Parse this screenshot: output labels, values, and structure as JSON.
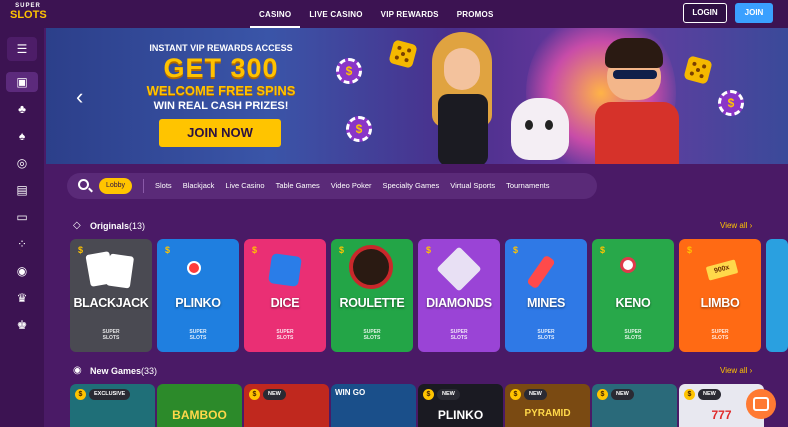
{
  "logo": {
    "top": "SUPER",
    "bottom": "SLOTS"
  },
  "nav": [
    {
      "label": "CASINO",
      "active": true
    },
    {
      "label": "LIVE CASINO",
      "active": false
    },
    {
      "label": "VIP REWARDS",
      "active": false
    },
    {
      "label": "PROMOS",
      "active": false
    }
  ],
  "auth": {
    "login": "LOGIN",
    "join": "JOIN"
  },
  "sidebar": {
    "menu_icon": "hamburger-menu-icon",
    "items": [
      {
        "icon": "casino-chips-icon",
        "glyph": "▣",
        "selected": true
      },
      {
        "icon": "cherry-icon",
        "glyph": "♣"
      },
      {
        "icon": "spade-icon",
        "glyph": "♠"
      },
      {
        "icon": "lottery-icon",
        "glyph": "◎"
      },
      {
        "icon": "cards-icon",
        "glyph": "▤"
      },
      {
        "icon": "laptop-icon",
        "glyph": "▭"
      },
      {
        "icon": "dice-dots-icon",
        "glyph": "⁘"
      },
      {
        "icon": "basketball-icon",
        "glyph": "◉"
      },
      {
        "icon": "trophy-icon",
        "glyph": "♛"
      },
      {
        "icon": "crown-icon",
        "glyph": "♚"
      }
    ]
  },
  "hero": {
    "line1": "INSTANT VIP REWARDS ACCESS",
    "line2": "GET 300",
    "line3": "WELCOME FREE SPINS",
    "line4": "WIN REAL CASH PRIZES!",
    "cta": "JOIN NOW",
    "prev_arrow": "‹",
    "chip_symbol": "$"
  },
  "search": {
    "active": "Lobby",
    "categories": [
      "Slots",
      "Blackjack",
      "Live Casino",
      "Table Games",
      "Video Poker",
      "Specialty Games",
      "Virtual Sports",
      "Tournaments"
    ]
  },
  "originals": {
    "title": "Originals",
    "count": "(13)",
    "view_all": "View all ›",
    "games": [
      {
        "name": "BLACKJACK",
        "color": "#4a4a52",
        "brand1": "SUPER",
        "brand2": "SLOTS"
      },
      {
        "name": "PLINKO",
        "color": "#1f7fe0",
        "brand1": "SUPER",
        "brand2": "SLOTS"
      },
      {
        "name": "DICE",
        "color": "#ea2f74",
        "brand1": "SUPER",
        "brand2": "SLOTS"
      },
      {
        "name": "ROULETTE",
        "color": "#23a547",
        "brand1": "SUPER",
        "brand2": "SLOTS"
      },
      {
        "name": "DIAMONDS",
        "color": "#9a44d6",
        "brand1": "SUPER",
        "brand2": "SLOTS"
      },
      {
        "name": "MINES",
        "color": "#2f79e6",
        "brand1": "SUPER",
        "brand2": "SLOTS"
      },
      {
        "name": "KENO",
        "color": "#28a84a",
        "brand1": "SUPER",
        "brand2": "SLOTS"
      },
      {
        "name": "LIMBO",
        "color": "#ff6a14",
        "brand1": "SUPER",
        "brand2": "SLOTS"
      }
    ],
    "dollar": "$",
    "limbo_tag": "900x"
  },
  "new_games": {
    "title": "New Games",
    "count": "(33)",
    "view_all": "View all ›",
    "games": [
      {
        "badge": "EXCLUSIVE",
        "color": "#1f6f78",
        "label": ""
      },
      {
        "badge": "",
        "color": "#2c8a2a",
        "label": "BAMBOO"
      },
      {
        "badge": "NEW",
        "color": "#c0281e",
        "label": ""
      },
      {
        "badge": "",
        "color": "#1a4f8a",
        "label": "WIN GO"
      },
      {
        "badge": "NEW",
        "color": "#1a1a22",
        "label": "PLINKO"
      },
      {
        "badge": "NEW",
        "color": "#7a4a12",
        "label": "PYRAMID"
      },
      {
        "badge": "NEW",
        "color": "#2a6a7a",
        "label": ""
      },
      {
        "badge": "NEW",
        "color": "#e8e8f0",
        "label": "777"
      }
    ]
  }
}
